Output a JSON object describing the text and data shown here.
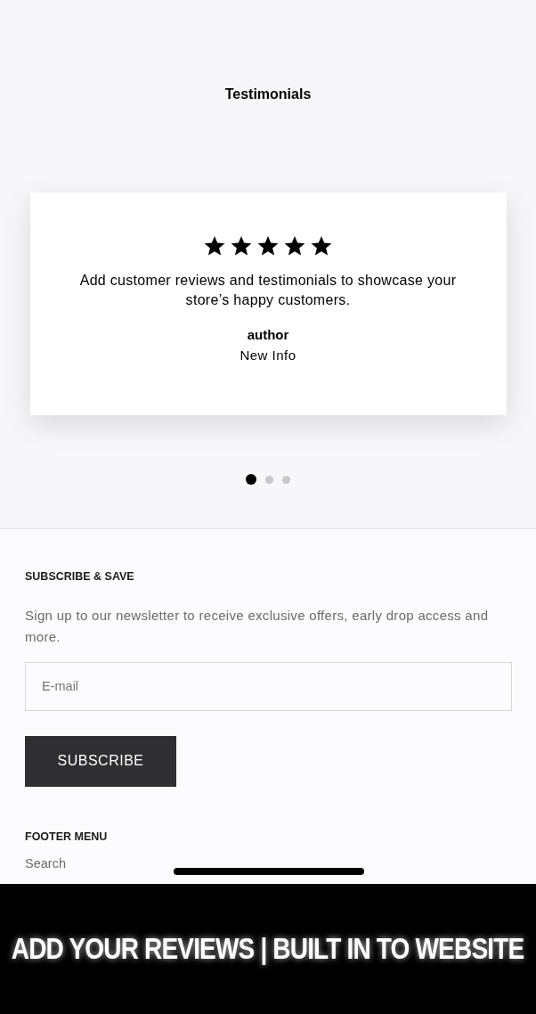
{
  "testimonials": {
    "title": "Testimonials",
    "card": {
      "stars": 5,
      "quote": "Add customer reviews and testimonials to showcase your store’s happy customers.",
      "author": "author",
      "info": "New Info"
    },
    "dots": [
      {
        "selected": true
      },
      {
        "selected": false
      },
      {
        "selected": false
      }
    ]
  },
  "newsletter": {
    "heading": "SUBSCRIBE & SAVE",
    "text": "Sign up to our newsletter to receive exclusive offers, early drop access and more.",
    "email": {
      "placeholder": "E-mail"
    },
    "button": "SUBSCRIBE"
  },
  "footer_menu": {
    "heading": "FOOTER MENU",
    "items": [
      "Search"
    ]
  },
  "caption": "ADD YOUR REVIEWS | BUILT IN TO WEBSITE"
}
